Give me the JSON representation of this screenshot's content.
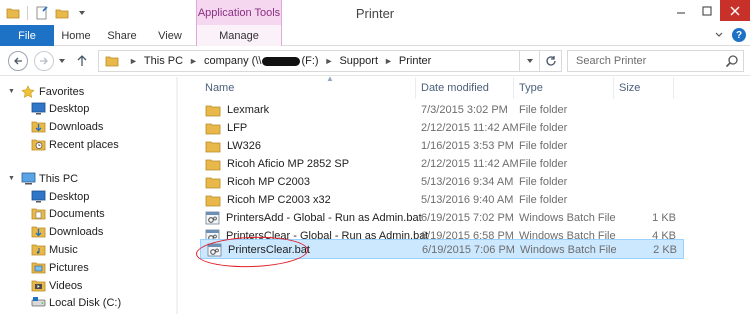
{
  "window": {
    "title": "Printer",
    "contextual_group": "Application Tools"
  },
  "ribbon": {
    "tabs": [
      "File",
      "Home",
      "Share",
      "View",
      "Manage"
    ]
  },
  "address": {
    "crumbs": [
      "This PC",
      "company (\\\\",
      "(F:)",
      "Support",
      "Printer"
    ],
    "search_placeholder": "Search Printer"
  },
  "navpane": {
    "items": [
      {
        "label": "Favorites",
        "icon": "star-icon",
        "level": 0
      },
      {
        "label": "Desktop",
        "icon": "desktop-icon",
        "level": 1
      },
      {
        "label": "Downloads",
        "icon": "downloads-icon",
        "level": 1
      },
      {
        "label": "Recent places",
        "icon": "recent-places-icon",
        "level": 1
      },
      {
        "label": "This PC",
        "icon": "computer-icon",
        "level": 0
      },
      {
        "label": "Desktop",
        "icon": "desktop-icon",
        "level": 1
      },
      {
        "label": "Documents",
        "icon": "documents-icon",
        "level": 1
      },
      {
        "label": "Downloads",
        "icon": "downloads-icon",
        "level": 1
      },
      {
        "label": "Music",
        "icon": "music-icon",
        "level": 1
      },
      {
        "label": "Pictures",
        "icon": "pictures-icon",
        "level": 1
      },
      {
        "label": "Videos",
        "icon": "videos-icon",
        "level": 1
      },
      {
        "label": "Local Disk (C:)",
        "icon": "local-disk-icon",
        "level": 1
      }
    ]
  },
  "columns": [
    "Name",
    "Date modified",
    "Type",
    "Size"
  ],
  "files": [
    {
      "name": "Lexmark",
      "date": "7/3/2015 3:02 PM",
      "type": "File folder",
      "size": "",
      "icon": "folder-icon"
    },
    {
      "name": "LFP",
      "date": "2/12/2015 11:42 AM",
      "type": "File folder",
      "size": "",
      "icon": "folder-icon"
    },
    {
      "name": "LW326",
      "date": "1/16/2015 3:53 PM",
      "type": "File folder",
      "size": "",
      "icon": "folder-icon"
    },
    {
      "name": "Ricoh Aficio MP 2852 SP",
      "date": "2/12/2015 11:42 AM",
      "type": "File folder",
      "size": "",
      "icon": "folder-icon"
    },
    {
      "name": "Ricoh MP C2003",
      "date": "5/13/2016 9:34 AM",
      "type": "File folder",
      "size": "",
      "icon": "folder-icon"
    },
    {
      "name": "Ricoh MP C2003 x32",
      "date": "5/13/2016 9:40 AM",
      "type": "File folder",
      "size": "",
      "icon": "folder-icon"
    },
    {
      "name": "PrintersAdd - Global - Run as Admin.bat",
      "date": "6/19/2015 7:02 PM",
      "type": "Windows Batch File",
      "size": "1 KB",
      "icon": "batch-file-icon"
    },
    {
      "name": "PrintersClear - Global - Run as Admin.bat",
      "date": "6/19/2015 6:58 PM",
      "type": "Windows Batch File",
      "size": "4 KB",
      "icon": "batch-file-icon"
    },
    {
      "name": "PrintersClear.bat",
      "date": "6/19/2015 7:06 PM",
      "type": "Windows Batch File",
      "size": "2 KB",
      "icon": "batch-file-icon",
      "selected": true
    }
  ],
  "colors": {
    "accent": "#1e72c5",
    "context_tab": "#f5d8f0",
    "context_text": "#8a2f82",
    "selection": "#cce8ff",
    "annotation": "#e0202a",
    "folder": "#e8b84a"
  }
}
